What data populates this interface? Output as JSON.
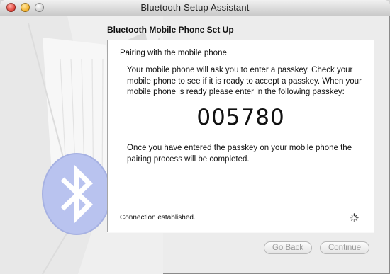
{
  "window": {
    "title": "Bluetooth Setup Assistant"
  },
  "section": {
    "header": "Bluetooth Mobile Phone Set Up"
  },
  "panel": {
    "heading": "Pairing with the mobile phone",
    "instructions": "Your mobile phone will ask you to enter a passkey. Check your mobile phone to see if it is ready to accept a passkey. When your mobile phone is ready please enter in the following passkey:",
    "passkey": "005780",
    "after_text": "Once you have entered the passkey on your mobile phone the pairing process will be completed.",
    "status": "Connection established."
  },
  "buttons": {
    "back": "Go Back",
    "continue": "Continue"
  },
  "icons": {
    "close": "close-button-icon",
    "minimize": "minimize-button-icon",
    "zoom": "zoom-button-icon",
    "bluetooth": "bluetooth-icon",
    "spinner": "spinner-icon"
  },
  "colors": {
    "bluetooth_blue": "#b9c3ef",
    "window_bg": "#ececec"
  }
}
